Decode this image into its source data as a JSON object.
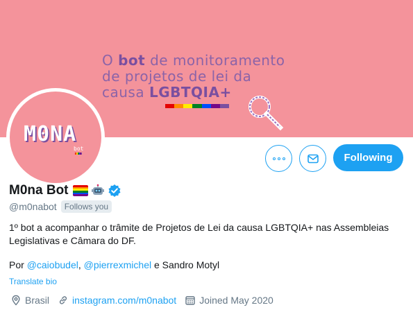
{
  "banner": {
    "line1_pre": "O ",
    "line1_bold": "bot",
    "line1_post": " de monitoramento",
    "line2": "de projetos de lei da",
    "line3_pre": "causa ",
    "line3_bold": "LGBTQIA+",
    "rainbow_colors": [
      "#e40303",
      "#ff8c00",
      "#ffed00",
      "#008026",
      "#004dff",
      "#750787",
      "#7a4fa0"
    ],
    "background_color": "#f4939b"
  },
  "avatar": {
    "logo_text": "M0NA",
    "sub_text": "bot"
  },
  "actions": {
    "more_icon": "more-icon",
    "message_icon": "envelope-icon",
    "following_label": "Following",
    "accent_color": "#1da1f2"
  },
  "profile": {
    "name": "M0na Bot",
    "handle": "@m0nabot",
    "follows_you": "Follows you",
    "bio_line1": "1º bot a acompanhar o trâmite de Projetos de Lei da causa LGBTQIA+ nas Assembleias Legislativas e Câmara do DF.",
    "credits_prefix": "Por ",
    "credit1": "@caiobudel",
    "credit_sep": ", ",
    "credit2": "@pierrexmichel",
    "credits_suffix": " e Sandro Motyl",
    "translate_bio": "Translate bio",
    "location": "Brasil",
    "website": "instagram.com/m0nabot",
    "joined": "Joined May 2020"
  }
}
